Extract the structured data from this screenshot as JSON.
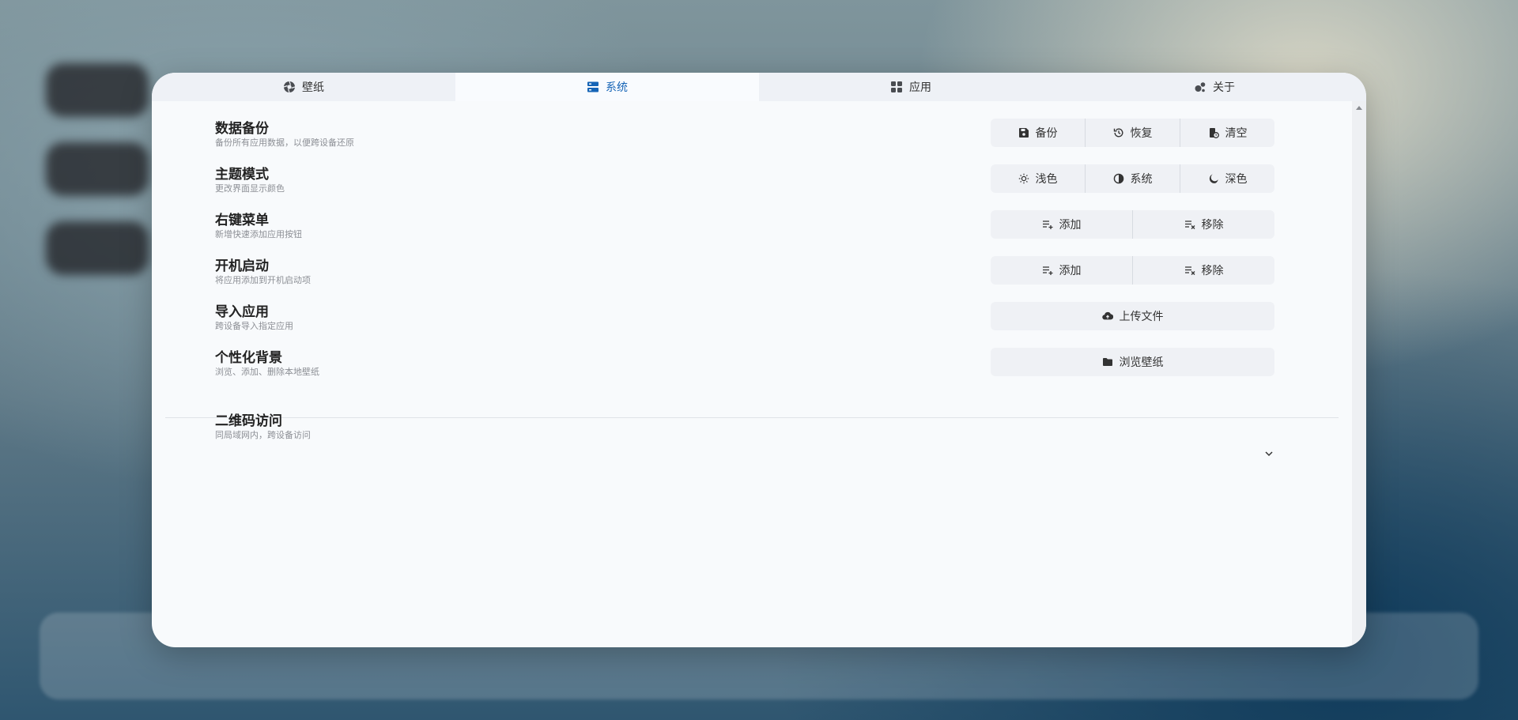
{
  "tabs": [
    {
      "label": "壁纸",
      "icon": "aperture-icon"
    },
    {
      "label": "系统",
      "icon": "server-icon"
    },
    {
      "label": "应用",
      "icon": "grid-icon"
    },
    {
      "label": "关于",
      "icon": "dots-icon"
    }
  ],
  "active_tab": "系统",
  "accent_color": "#1664b6",
  "settings": [
    {
      "title": "数据备份",
      "desc": "备份所有应用数据，以便跨设备还原",
      "buttons": [
        {
          "label": "备份",
          "icon": "save-icon"
        },
        {
          "label": "恢复",
          "icon": "history-icon"
        },
        {
          "label": "清空",
          "icon": "trash-clock-icon"
        }
      ]
    },
    {
      "title": "主题模式",
      "desc": "更改界面显示颜色",
      "buttons": [
        {
          "label": "浅色",
          "icon": "sun-icon"
        },
        {
          "label": "系统",
          "icon": "half-circle-icon"
        },
        {
          "label": "深色",
          "icon": "moon-icon"
        }
      ]
    },
    {
      "title": "右键菜单",
      "desc": "新增快速添加应用按钮",
      "buttons": [
        {
          "label": "添加",
          "icon": "list-add-icon"
        },
        {
          "label": "移除",
          "icon": "list-remove-icon"
        }
      ]
    },
    {
      "title": "开机启动",
      "desc": "将应用添加到开机启动项",
      "buttons": [
        {
          "label": "添加",
          "icon": "list-add-icon"
        },
        {
          "label": "移除",
          "icon": "list-remove-icon"
        }
      ]
    },
    {
      "title": "导入应用",
      "desc": "跨设备导入指定应用",
      "buttons": [
        {
          "label": "上传文件",
          "icon": "cloud-upload-icon"
        }
      ]
    },
    {
      "title": "个性化背景",
      "desc": "浏览、添加、删除本地壁纸",
      "buttons": [
        {
          "label": "浏览壁纸",
          "icon": "folder-icon"
        }
      ]
    }
  ],
  "qr_section": {
    "title": "二维码访问",
    "desc": "同局域网内，跨设备访问"
  }
}
